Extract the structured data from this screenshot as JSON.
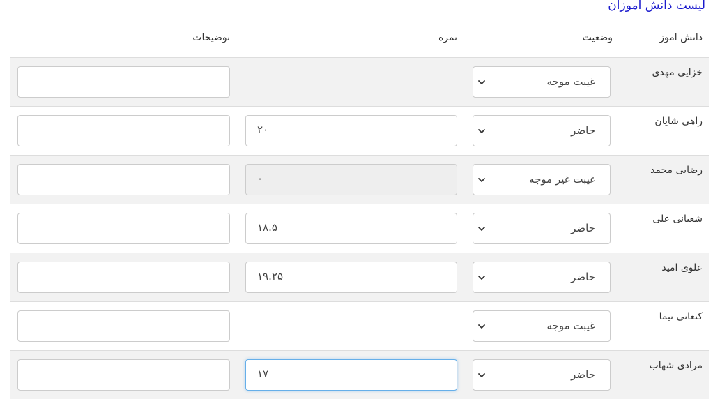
{
  "page": {
    "title": "لیست دانش آموزان"
  },
  "table": {
    "headers": {
      "student": "دانش اموز",
      "status": "وضعیت",
      "grade": "نمره",
      "notes": "توضیحات"
    },
    "rows": [
      {
        "name": "خزایی مهدی",
        "status": "غیبت موجه",
        "grade": null,
        "notes": ""
      },
      {
        "name": "راهی شایان",
        "status": "حاضر",
        "grade": "۲۰",
        "notes": ""
      },
      {
        "name": "رضایی محمد",
        "status": "غیبت غیر موجه",
        "grade": "۰",
        "grade_disabled": true,
        "notes": ""
      },
      {
        "name": "شعبانی علی",
        "status": "حاضر",
        "grade": "۱۸.۵",
        "notes": ""
      },
      {
        "name": "علوی امید",
        "status": "حاضر",
        "grade": "۱۹.۲۵",
        "notes": ""
      },
      {
        "name": "کنعانی نیما",
        "status": "غیبت موجه",
        "grade": null,
        "notes": ""
      },
      {
        "name": "مرادی شهاب",
        "status": "حاضر",
        "grade": "۱۷",
        "grade_focused": true,
        "notes": ""
      }
    ]
  },
  "icons": {
    "select_arrow": "chevron-down-icon"
  },
  "colors": {
    "title_link": "#1a1acd",
    "row_stripe": "#f2f2f2",
    "focus_border": "#66afe9",
    "disabled_bg": "#eeeeee"
  }
}
